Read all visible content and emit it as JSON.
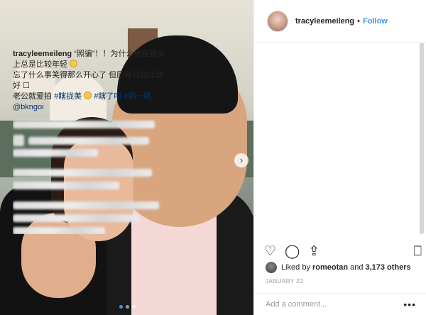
{
  "post": {
    "carousel": {
      "total": 3,
      "active": 1
    },
    "next_icon": "chevron-right-icon"
  },
  "header": {
    "username": "tracyleemeileng",
    "separator": "•",
    "follow_label": "Follow"
  },
  "caption": {
    "username": "tracyleemeileng",
    "line1": " “照骗”！！为什么他在镜头上总是比较年轻 ",
    "line2": "忘了什么事笑得那么开心了 但愿每日如此就好 ",
    "line3_prefix": "老公就爱拍 ",
    "tags": [
      "#瞎拢美",
      "#瞎了咁",
      "#晒一晒"
    ],
    "mention": "@bkngoi"
  },
  "actions": {
    "like_icon": "heart-icon",
    "comment_icon": "comment-icon",
    "share_icon": "share-icon",
    "save_icon": "bookmark-icon"
  },
  "likes": {
    "prefix": "Liked by",
    "user": "romeotan",
    "conjunction": "and",
    "others": "3,173 others"
  },
  "date": "JANUARY 22",
  "comment": {
    "placeholder": "Add a comment...",
    "more_label": "•••"
  },
  "colors": {
    "link_blue": "#3897f0",
    "hashtag": "#003569",
    "text": "#262626",
    "muted": "#999999"
  }
}
